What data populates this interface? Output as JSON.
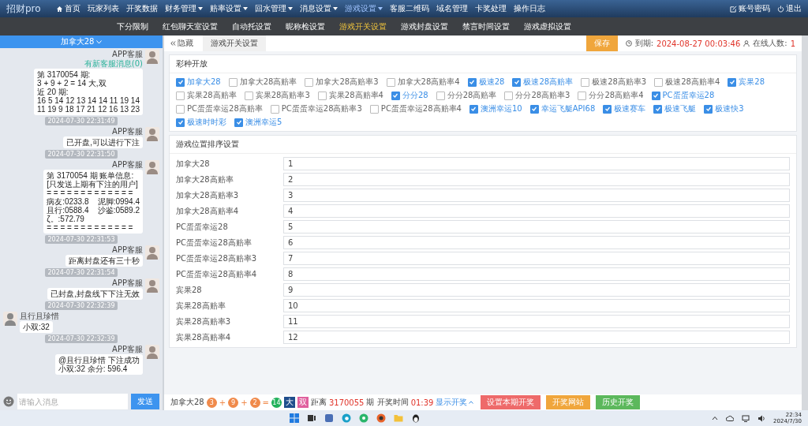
{
  "nav": {
    "logo": "招财pro",
    "items": [
      {
        "label": "首页",
        "dropdown": false,
        "selected": false
      },
      {
        "label": "玩家列表",
        "dropdown": false,
        "selected": false
      },
      {
        "label": "开奖数据",
        "dropdown": false,
        "selected": false
      },
      {
        "label": "财务管理",
        "dropdown": true,
        "selected": false
      },
      {
        "label": "赔率设置",
        "dropdown": true,
        "selected": false
      },
      {
        "label": "回水管理",
        "dropdown": true,
        "selected": false
      },
      {
        "label": "消息设置",
        "dropdown": true,
        "selected": false
      },
      {
        "label": "游戏设置",
        "dropdown": true,
        "selected": true
      },
      {
        "label": "客服二维码",
        "dropdown": false,
        "selected": false
      },
      {
        "label": "域名管理",
        "dropdown": false,
        "selected": false
      },
      {
        "label": "卡奖处理",
        "dropdown": false,
        "selected": false
      },
      {
        "label": "操作日志",
        "dropdown": false,
        "selected": false
      }
    ],
    "right": [
      {
        "label": "账号密码",
        "kind": "edit"
      },
      {
        "label": "退出",
        "kind": "power"
      }
    ]
  },
  "subnav": [
    {
      "label": "下分限制",
      "selected": false
    },
    {
      "label": "红包聊天室设置",
      "selected": false
    },
    {
      "label": "自动托设置",
      "selected": false
    },
    {
      "label": "昵称检设置",
      "selected": false
    },
    {
      "label": "游戏开关设置",
      "selected": true
    },
    {
      "label": "游戏封盘设置",
      "selected": false
    },
    {
      "label": "禁言时间设置",
      "selected": false
    },
    {
      "label": "游戏虚拟设置",
      "selected": false
    }
  ],
  "chat": {
    "channel": "加拿大28",
    "messages": [
      {
        "kind": "agent",
        "name": "APP客服",
        "badge": "有新客服消息(0)",
        "lines": [
          "第 3170054 期:",
          "3 + 9 + 2 = 14 大,双",
          "近 20 期:",
          "16 5 14 12 13 14 14 11 19 14",
          "11 19 9 18 17 21 12 16 13 23"
        ]
      },
      {
        "kind": "timestamp",
        "text": "2024-07-30 22:31:49"
      },
      {
        "kind": "agent",
        "name": "APP客服",
        "lines": [
          "已开盘,可以进行下注"
        ]
      },
      {
        "kind": "timestamp",
        "text": "2024-07-30 22:31:50"
      },
      {
        "kind": "agent",
        "name": "APP客服",
        "lines": [
          "第 3170054 期 账单信息:",
          "[只发送上期有下注的用户]",
          "= = = = = = = = = = = = =",
          "病友:0233.8    泥脚:0994.4",
          "且行:0588.4    沙鉴:0589.2",
          "ζ。:572.79",
          "= = = = = = = = = = = = ="
        ]
      },
      {
        "kind": "timestamp",
        "text": "2024-07-30 22:31:53"
      },
      {
        "kind": "agent",
        "name": "APP客服",
        "lines": [
          "距离封盘还有三十秒"
        ]
      },
      {
        "kind": "timestamp",
        "text": "2024-07-30 22:31:54"
      },
      {
        "kind": "agent",
        "name": "APP客服",
        "lines": [
          "已封盘,封盘线下下注无效"
        ]
      },
      {
        "kind": "timestamp",
        "text": "2024-07-30 22:32:39"
      },
      {
        "kind": "user",
        "name": "且行且珍惜",
        "lines": [
          "小双:32"
        ]
      },
      {
        "kind": "timestamp",
        "text": "2024-07-30 22:32:39"
      },
      {
        "kind": "agent",
        "name": "APP客服",
        "lines": [
          "@且行且珍惜 下注成功",
          "小双:32 余分: 596.4"
        ]
      }
    ],
    "placeholder": "请输入消息",
    "send": "发送"
  },
  "main": {
    "hide": "隐藏",
    "tab": "游戏开关设置",
    "save": "保存",
    "expiry_label": "到期:",
    "expiry": "2024-08-27 00:03:46",
    "online_label": "在线人数:",
    "online": "1"
  },
  "lottery_section": {
    "title": "彩种开放",
    "options": [
      {
        "label": "加拿大28",
        "checked": true
      },
      {
        "label": "加拿大28高赔率",
        "checked": false
      },
      {
        "label": "加拿大28高赔率3",
        "checked": false
      },
      {
        "label": "加拿大28高赔率4",
        "checked": false
      },
      {
        "label": "极速28",
        "checked": true
      },
      {
        "label": "极速28高赔率",
        "checked": true
      },
      {
        "label": "极速28高赔率3",
        "checked": false
      },
      {
        "label": "极速28高赔率4",
        "checked": false
      },
      {
        "label": "宾果28",
        "checked": true
      },
      {
        "label": "宾果28高赔率",
        "checked": false
      },
      {
        "label": "宾果28高赔率3",
        "checked": false
      },
      {
        "label": "宾果28高赔率4",
        "checked": false
      },
      {
        "label": "分分28",
        "checked": true
      },
      {
        "label": "分分28高赔率",
        "checked": false
      },
      {
        "label": "分分28高赔率3",
        "checked": false
      },
      {
        "label": "分分28高赔率4",
        "checked": false
      },
      {
        "label": "PC蛋蛋幸运28",
        "checked": true
      },
      {
        "label": "PC蛋蛋幸运28高赔率",
        "checked": false
      },
      {
        "label": "PC蛋蛋幸运28高赔率3",
        "checked": false
      },
      {
        "label": "PC蛋蛋幸运28高赔率4",
        "checked": false
      },
      {
        "label": "澳洲幸运10",
        "checked": true
      },
      {
        "label": "幸运飞艇API68",
        "checked": true
      },
      {
        "label": "极速赛车",
        "checked": true
      },
      {
        "label": "极速飞艇",
        "checked": true
      },
      {
        "label": "极速快3",
        "checked": true
      },
      {
        "label": "极速时时彩",
        "checked": true
      },
      {
        "label": "澳洲幸运5",
        "checked": true
      }
    ]
  },
  "order_section": {
    "title": "游戏位置排序设置",
    "rows": [
      {
        "label": "加拿大28",
        "value": "1"
      },
      {
        "label": "加拿大28高赔率",
        "value": "2"
      },
      {
        "label": "加拿大28高赔率3",
        "value": "3"
      },
      {
        "label": "加拿大28高赔率4",
        "value": "4"
      },
      {
        "label": "PC蛋蛋幸运28",
        "value": "5"
      },
      {
        "label": "PC蛋蛋幸运28高赔率",
        "value": "6"
      },
      {
        "label": "PC蛋蛋幸运28高赔率3",
        "value": "7"
      },
      {
        "label": "PC蛋蛋幸运28高赔率4",
        "value": "8"
      },
      {
        "label": "宾果28",
        "value": "9"
      },
      {
        "label": "宾果28高赔率",
        "value": "10"
      },
      {
        "label": "宾果28高赔率3",
        "value": "11"
      },
      {
        "label": "宾果28高赔率4",
        "value": "12"
      }
    ]
  },
  "draw_bar": {
    "game": "加拿大28",
    "result": [
      {
        "kind": "ball",
        "text": "3"
      },
      {
        "kind": "op",
        "text": "+"
      },
      {
        "kind": "ball",
        "text": "9"
      },
      {
        "kind": "op",
        "text": "+"
      },
      {
        "kind": "ball",
        "text": "2"
      },
      {
        "kind": "op",
        "text": "="
      },
      {
        "kind": "sum",
        "text": "14"
      },
      {
        "kind": "size",
        "text": "大"
      },
      {
        "kind": "parity",
        "text": "双"
      }
    ],
    "distance": "距离",
    "period": "3170055",
    "period_suffix": "期 开奖时间",
    "countdown": "01:39",
    "toggle": "显示开奖",
    "buttons": [
      {
        "label": "设置本期开奖",
        "kind": "danger"
      },
      {
        "label": "开奖网站",
        "kind": "warning"
      },
      {
        "label": "历史开奖",
        "kind": "success"
      }
    ]
  },
  "taskbar": {
    "time": "22:34",
    "date": "2024/7/30"
  }
}
